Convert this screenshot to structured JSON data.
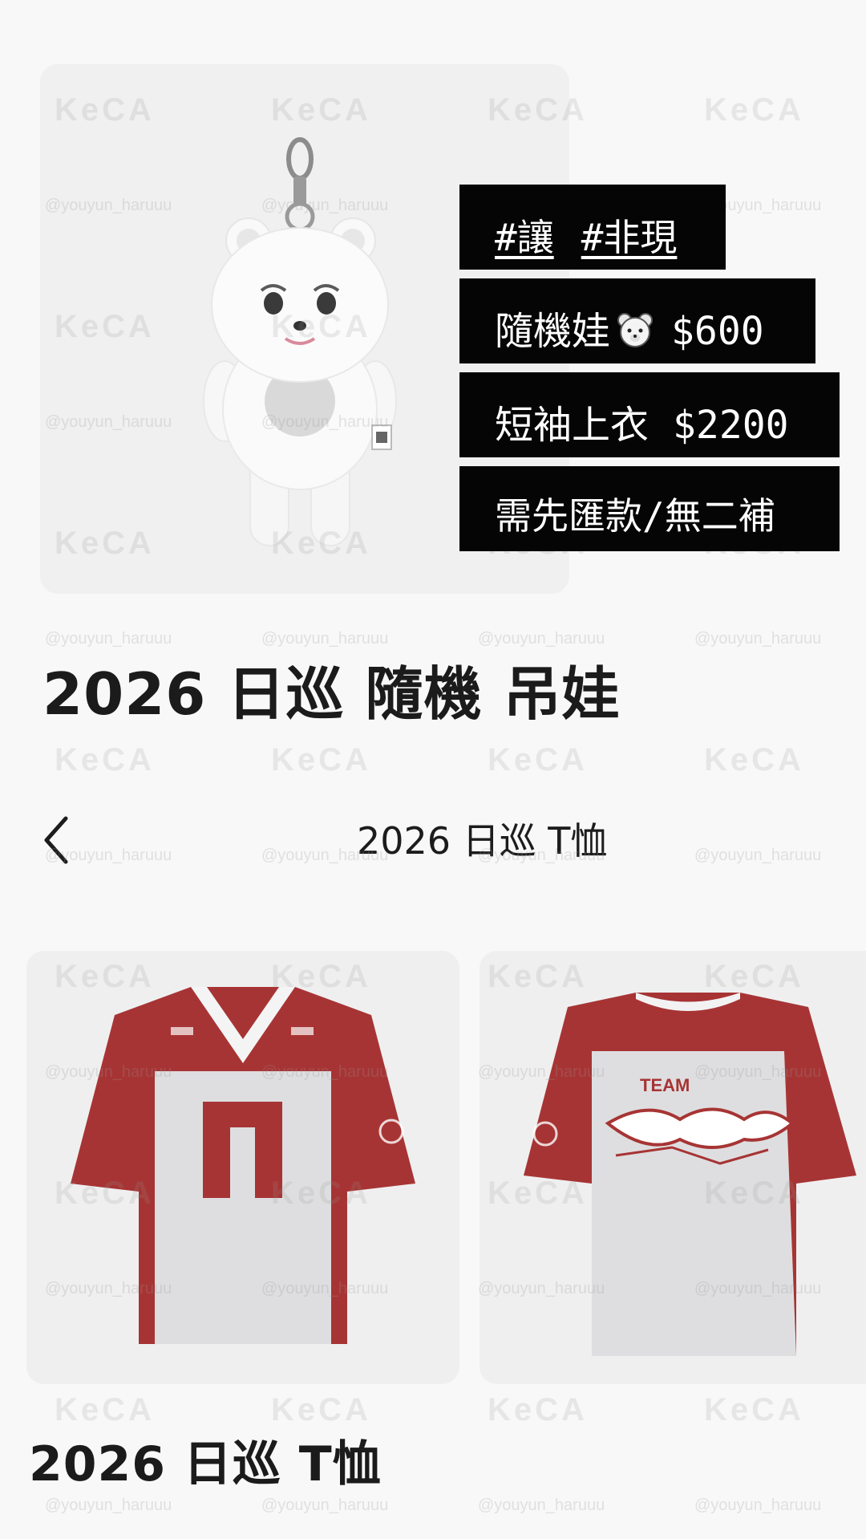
{
  "products": {
    "bear": {
      "title": "2026 日巡 隨機 吊娃"
    },
    "shirt": {
      "title": "2026 日巡 T恤"
    }
  },
  "nav": {
    "title": "2026 日巡 T恤",
    "back_icon": "chevron-left-icon"
  },
  "overlay": {
    "tag1": "#讓",
    "tag2": "#非現",
    "bear_label": "隨機娃",
    "bear_price": "$600",
    "shirt_label": "短袖上衣",
    "shirt_price": "$2200",
    "note": "需先匯款/無二補"
  },
  "watermark": {
    "brand": "KeCA",
    "handle": "@youyun_haruuu"
  },
  "colors": {
    "shirt_red": "#a73434",
    "label_bg": "#050505",
    "background": "#f8f8f9"
  }
}
